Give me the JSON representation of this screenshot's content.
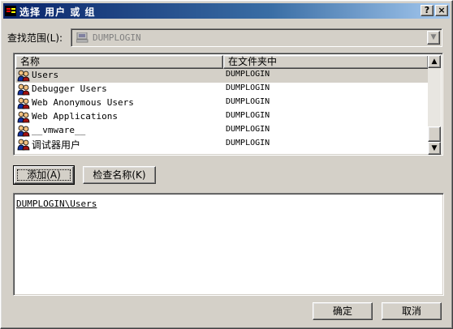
{
  "window": {
    "title": "选择 用户 或 组",
    "help_button": "?",
    "close_button": "×"
  },
  "look_in": {
    "label": "查找范围(L):",
    "value": "DUMPLOGIN",
    "dropdown_arrow": "▼"
  },
  "list": {
    "columns": [
      "名称",
      "在文件夹中"
    ],
    "rows": [
      {
        "name": "Users",
        "folder": "DUMPLOGIN",
        "selected": true
      },
      {
        "name": "Debugger Users",
        "folder": "DUMPLOGIN",
        "selected": false
      },
      {
        "name": "Web Anonymous Users",
        "folder": "DUMPLOGIN",
        "selected": false
      },
      {
        "name": "Web Applications",
        "folder": "DUMPLOGIN",
        "selected": false
      },
      {
        "name": "__vmware__",
        "folder": "DUMPLOGIN",
        "selected": false
      },
      {
        "name": "调试器用户",
        "folder": "DUMPLOGIN",
        "selected": false
      }
    ],
    "scroll_up": "▲",
    "scroll_down": "▼",
    "icon": "user-group-icon"
  },
  "buttons": {
    "add": "添加(A)",
    "check_names": "检查名称(K)",
    "ok": "确定",
    "cancel": "取消"
  },
  "selected_names": {
    "entries": [
      "DUMPLOGIN\\Users"
    ]
  },
  "colors": {
    "title_gradient_start": "#0a246a",
    "title_gradient_end": "#a6caf0",
    "face": "#d4d0c8"
  }
}
